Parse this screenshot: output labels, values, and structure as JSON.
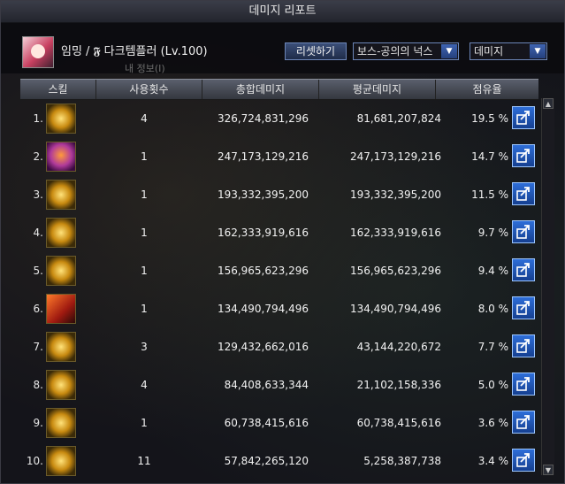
{
  "window": {
    "title": "데미지 리포트"
  },
  "character": {
    "name": "임밍 / 𝕱 다크템플러 (Lv.100)"
  },
  "controls": {
    "reset_label": "리셋하기",
    "boss_select": "보스-공의의 넉스",
    "metric_select": "데미지"
  },
  "background_text": "내 정보(I)",
  "table": {
    "headers": [
      "스킬",
      "사용횟수",
      "총합데미지",
      "평균데미지",
      "점유율"
    ],
    "rows": [
      {
        "rank": "1.",
        "count": "4",
        "total": "326,724,831,296",
        "avg": "81,681,207,824",
        "pct": "19.5 %",
        "icon": "gold-sun-skill-icon"
      },
      {
        "rank": "2.",
        "count": "1",
        "total": "247,173,129,216",
        "avg": "247,173,129,216",
        "pct": "14.7 %",
        "icon": "purple-flame-skill-icon"
      },
      {
        "rank": "3.",
        "count": "1",
        "total": "193,332,395,200",
        "avg": "193,332,395,200",
        "pct": "11.5 %",
        "icon": "gold-ring-skill-icon"
      },
      {
        "rank": "4.",
        "count": "1",
        "total": "162,333,919,616",
        "avg": "162,333,919,616",
        "pct": "9.7 %",
        "icon": "gold-wing-skill-icon"
      },
      {
        "rank": "5.",
        "count": "1",
        "total": "156,965,623,296",
        "avg": "156,965,623,296",
        "pct": "9.4 %",
        "icon": "gold-burst-skill-icon"
      },
      {
        "rank": "6.",
        "count": "1",
        "total": "134,490,794,496",
        "avg": "134,490,794,496",
        "pct": "8.0 %",
        "icon": "red-cross-slash-skill-icon"
      },
      {
        "rank": "7.",
        "count": "3",
        "total": "129,432,662,016",
        "avg": "43,144,220,672",
        "pct": "7.7 %",
        "icon": "gold-beam-skill-icon"
      },
      {
        "rank": "8.",
        "count": "4",
        "total": "84,408,633,344",
        "avg": "21,102,158,336",
        "pct": "5.0 %",
        "icon": "gold-slash-skill-icon"
      },
      {
        "rank": "9.",
        "count": "1",
        "total": "60,738,415,616",
        "avg": "60,738,415,616",
        "pct": "3.6 %",
        "icon": "gold-spark-skill-icon"
      },
      {
        "rank": "10.",
        "count": "11",
        "total": "57,842,265,120",
        "avg": "5,258,387,738",
        "pct": "3.4 %",
        "icon": "gold-orb-skill-icon"
      }
    ]
  }
}
